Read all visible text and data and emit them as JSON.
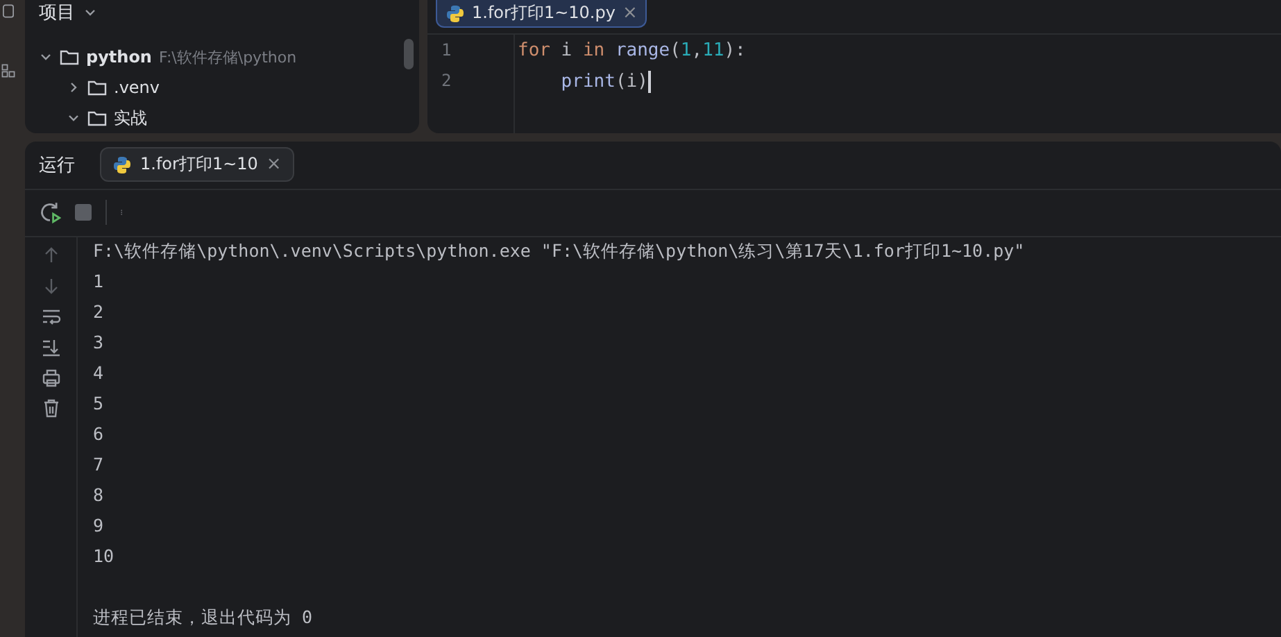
{
  "project": {
    "title": "项目",
    "tree": [
      {
        "label": "python",
        "path": "F:\\软件存储\\python",
        "expanded": true,
        "children": [
          {
            "label": ".venv",
            "expanded": false
          },
          {
            "label": "实战",
            "expanded": true
          }
        ]
      }
    ]
  },
  "editor": {
    "tab": {
      "label": "1.for打印1~10.py",
      "close": "×"
    },
    "lines": [
      {
        "number": "1",
        "tokens": [
          {
            "text": "for",
            "kind": "keyword"
          },
          {
            "text": " i ",
            "kind": "plain"
          },
          {
            "text": "in",
            "kind": "keyword"
          },
          {
            "text": " range",
            "kind": "func"
          },
          {
            "text": "(",
            "kind": "punct"
          },
          {
            "text": "1",
            "kind": "number"
          },
          {
            "text": ",",
            "kind": "punct"
          },
          {
            "text": "11",
            "kind": "number"
          },
          {
            "text": "):",
            "kind": "punct"
          }
        ]
      },
      {
        "number": "2",
        "tokens": [
          {
            "text": "    print",
            "kind": "func"
          },
          {
            "text": "(",
            "kind": "punct"
          },
          {
            "text": "i",
            "kind": "plain"
          },
          {
            "text": ")",
            "kind": "punct"
          }
        ]
      }
    ]
  },
  "run": {
    "title": "运行",
    "tab": {
      "label": "1.for打印1~10",
      "close": "×"
    },
    "output": [
      {
        "text": "F:\\软件存储\\python\\.venv\\Scripts\\python.exe \"F:\\软件存储\\python\\练习\\第17天\\1.for打印1~10.py\""
      },
      {
        "text": "1"
      },
      {
        "text": "2"
      },
      {
        "text": "3"
      },
      {
        "text": "4"
      },
      {
        "text": "5"
      },
      {
        "text": "6"
      },
      {
        "text": "7"
      },
      {
        "text": "8"
      },
      {
        "text": "9"
      },
      {
        "text": "10"
      }
    ],
    "exit": "进程已结束，退出代码为 0"
  }
}
